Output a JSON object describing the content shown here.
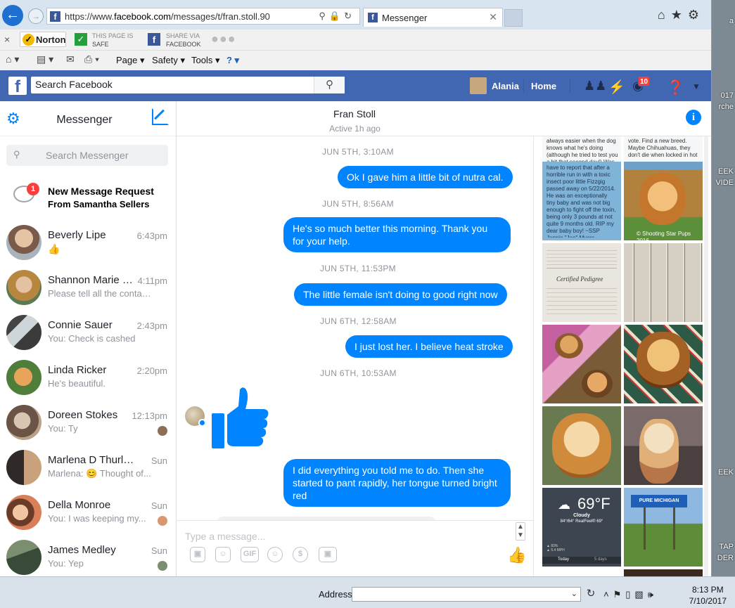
{
  "browser": {
    "url_prefix": "https://www.",
    "url_domain": "facebook.com",
    "url_path": "/messages/t/fran.stoll.90",
    "tab_title": "Messenger",
    "tab_close": "✕"
  },
  "norton": {
    "close": "×",
    "logo_label": "Norton",
    "safe_line1": "THIS PAGE IS",
    "safe_line2": "SAFE",
    "share_line1": "SHARE VIA",
    "share_line2": "FACEBOOK"
  },
  "commandbar": {
    "page": "Page ▾",
    "safety": "Safety ▾",
    "tools": "Tools ▾",
    "help": "? ▾"
  },
  "facebook": {
    "search_placeholder": "Search Facebook",
    "user_name": "Alania",
    "home": "Home",
    "notif_count": "10"
  },
  "messenger": {
    "title": "Messenger",
    "search_placeholder": "Search Messenger",
    "request_badge": "1",
    "request_title": "New Message Request",
    "request_sub": "From Samantha Sellers",
    "conversations": [
      {
        "name": "Beverly Lipe",
        "time": "6:43pm",
        "preview": ""
      },
      {
        "name": "Shannon Marie C...",
        "time": "4:11pm",
        "preview": "Please tell all the contac..."
      },
      {
        "name": "Connie Sauer",
        "time": "2:43pm",
        "preview": "You: Check is cashed"
      },
      {
        "name": "Linda Ricker",
        "time": "2:20pm",
        "preview": "He's beautiful."
      },
      {
        "name": "Doreen Stokes",
        "time": "12:13pm",
        "preview": "You: Ty"
      },
      {
        "name": "Marlena D Thurlow",
        "time": "Sun",
        "preview": "Marlena: 😊 Thought of..."
      },
      {
        "name": "Della Monroe",
        "time": "Sun",
        "preview": "You: I was keeping my..."
      },
      {
        "name": "James Medley",
        "time": "Sun",
        "preview": "You: Yep"
      }
    ]
  },
  "conversation": {
    "name": "Fran Stoll",
    "status": "Active 1h ago",
    "info": "i",
    "messages": [
      {
        "ts": "JUN 5TH, 3:10AM",
        "text": "Ok I gave him a little bit of nutra cal."
      },
      {
        "ts": "JUN 5TH, 8:56AM",
        "text": "He's so much better this morning.  Thank you for your help."
      },
      {
        "ts": "JUN 5TH, 11:53PM",
        "text": "The little female isn't doing to good right now"
      },
      {
        "ts": "JUN 6TH, 12:58AM",
        "text": "I just lost her.  I believe heat stroke"
      },
      {
        "ts": "JUN 6TH, 10:53AM",
        "text": ""
      },
      {
        "ts": "",
        "text": "I did everything you told me to do.  Then she started to pant rapidly, her tongue turned bright red"
      }
    ],
    "composer_placeholder": "Type a message...",
    "gif": "GIF"
  },
  "media": {
    "text_1a": "always easier when the dog knows what he's doing (although he tried to test you a bit that second day!) Was nice to meet you too.",
    "text_1b": "vote. Find a new breed. Maybe Chihuahuas, they don't die when locked in hot",
    "text_2a": "have to report that after a horrible run in with a toxic insect poor little Fizzgig passed away on 5/22/2014. He was an exceptionally tiny baby and was not big enough to fight off the toxin, being only 3 pounds at not quite 9 months old. RIP my dear baby boy! ~SSP Jennie \"Jae\" Myers",
    "text_2b": "© Shooting Star Pups 2016",
    "text_cert": "Certified Pedigree",
    "weather_temp": "69°F",
    "weather_cond": "Cloudy",
    "weather_detail": "84°/64° RealFeel® 69°",
    "weather_stats": "▲ 83%\n▲ 5.4 MPH",
    "weather_today": "Today",
    "weather_days": "5 days",
    "mi_brand": "PURE MICHIGAN"
  },
  "desktop": {
    "t1": "017",
    "t2": "rche",
    "t3": "EEK",
    "t4": "VIDE",
    "t5": "EEK",
    "t6": "TAP",
    "t7": "DER",
    "t8": "a"
  },
  "taskbar": {
    "address_label": "Address",
    "time": "8:13 PM",
    "date": "7/10/2017"
  }
}
